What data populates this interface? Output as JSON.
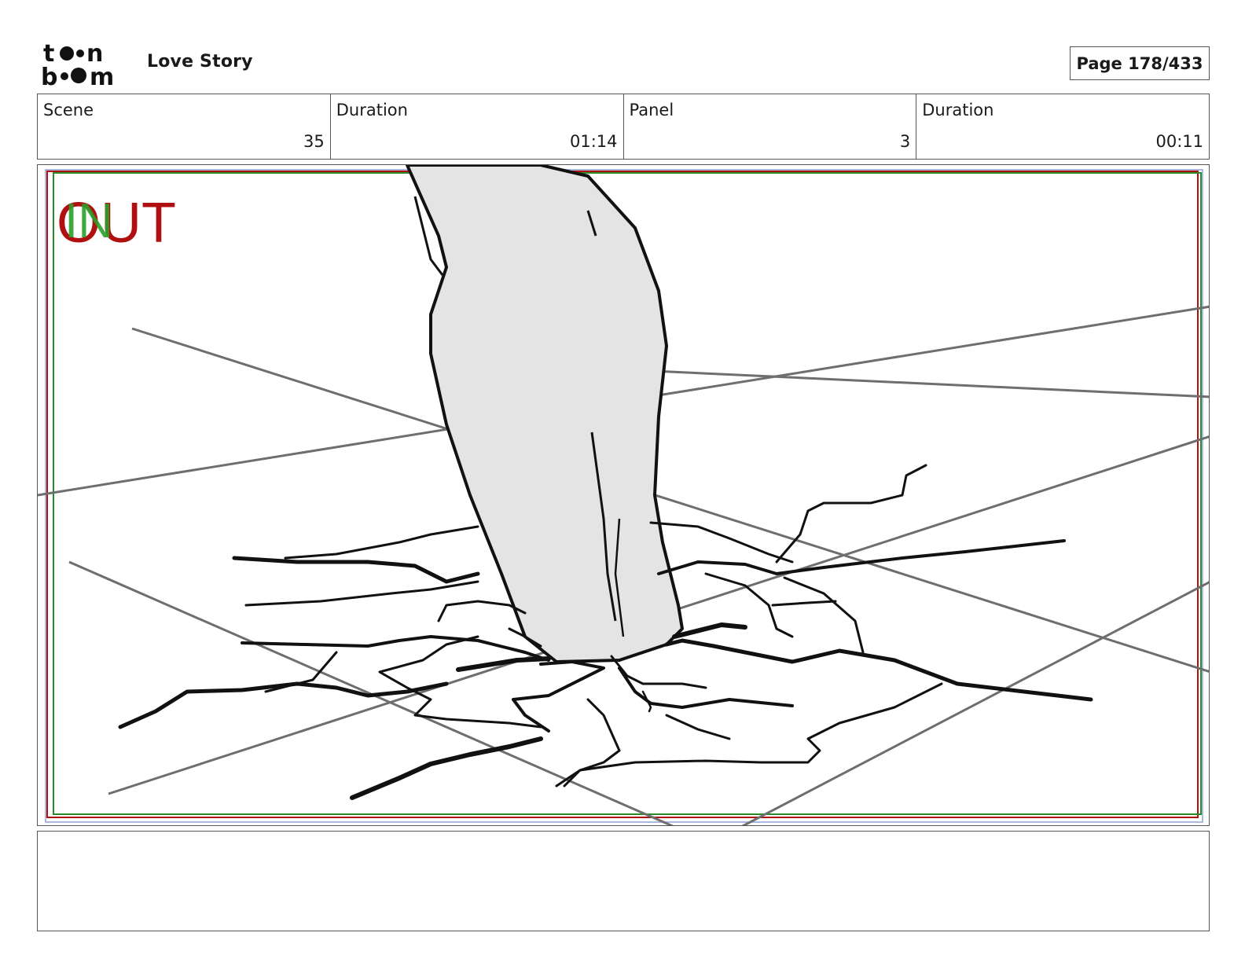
{
  "header": {
    "project_title": "Love Story",
    "page_label": "Page 178/433"
  },
  "logo": {
    "text": "toon boom"
  },
  "info": {
    "scene_label": "Scene",
    "scene_value": "35",
    "scene_duration_label": "Duration",
    "scene_duration_value": "01:14",
    "panel_label": "Panel",
    "panel_value": "3",
    "panel_duration_label": "Duration",
    "panel_duration_value": "00:11"
  },
  "panel": {
    "marker_in": "IN",
    "marker_out": "OUT",
    "out_color": "#b01010",
    "in_color": "#2aa02a"
  },
  "caption": {
    "text": ""
  }
}
